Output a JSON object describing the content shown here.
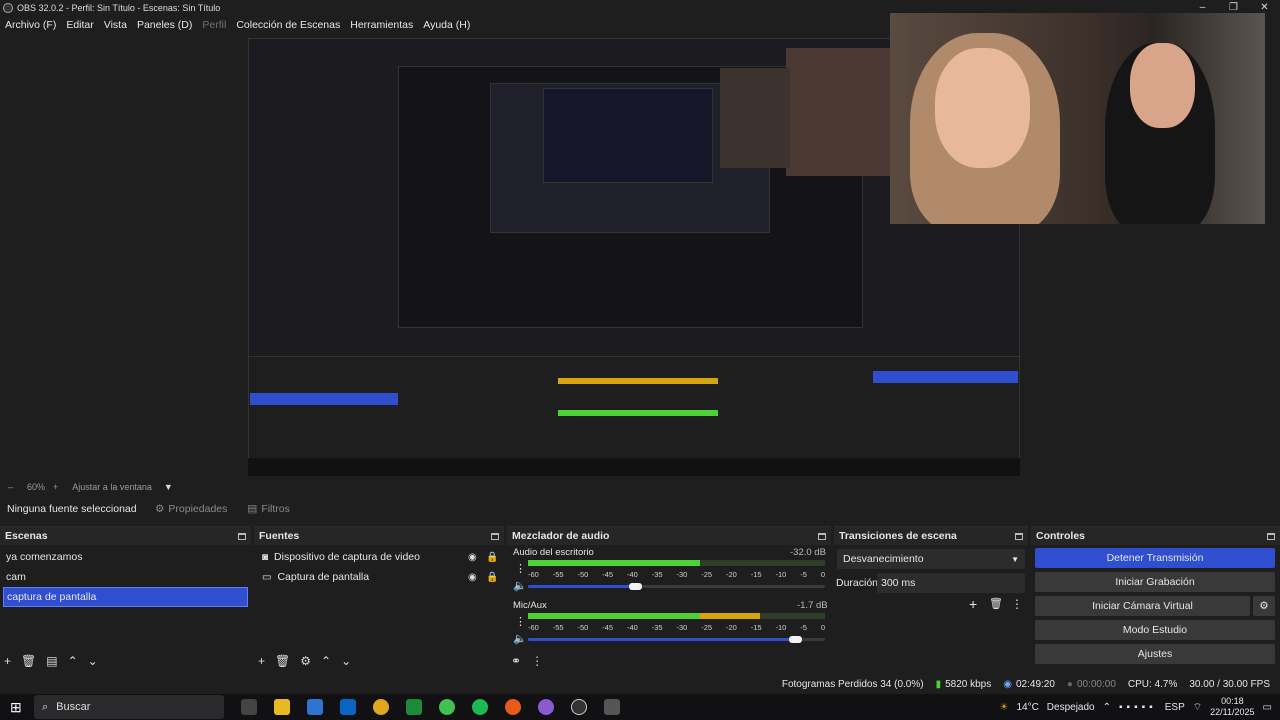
{
  "window": {
    "title": "OBS 32.0.2 - Perfil: Sin Título - Escenas: Sin Título",
    "controls": [
      "–",
      "❐",
      "✕"
    ]
  },
  "menu": [
    "Archivo (F)",
    "Editar",
    "Vista",
    "Paneles (D)",
    "Perfil",
    "Colección de Escenas",
    "Herramientas",
    "Ayuda (H)"
  ],
  "zoom": {
    "minus": "–",
    "value": "60%",
    "plus": "+",
    "fit": "Ajustar a la ventana"
  },
  "context": {
    "no_source": "Ninguna fuente seleccionad",
    "properties": "Propiedades",
    "filters": "Filtros"
  },
  "scenes": {
    "title": "Escenas",
    "items": [
      "ya comenzamos",
      "cam",
      "captura de pantalla"
    ],
    "selected": 2
  },
  "sources": {
    "title": "Fuentes",
    "items": [
      "Dispositivo de captura de video",
      "Captura de pantalla"
    ]
  },
  "mixer": {
    "title": "Mezclador de audio",
    "channels": [
      {
        "name": "Audio del escritorio",
        "db": "-32.0 dB",
        "level": 0.58,
        "volume": 0.36
      },
      {
        "name": "Mic/Aux",
        "db": "-1.7 dB",
        "level": 0.78,
        "volume": 0.9
      }
    ],
    "scale": [
      "-60",
      "-55",
      "-50",
      "-45",
      "-40",
      "-35",
      "-30",
      "-25",
      "-20",
      "-15",
      "-10",
      "-5",
      "0"
    ]
  },
  "transitions": {
    "title": "Transiciones de escena",
    "selected": "Desvanecimiento",
    "duration_label": "Duración",
    "duration_value": "300 ms"
  },
  "controls": {
    "title": "Controles",
    "buttons": [
      "Detener Transmisión",
      "Iniciar Grabación",
      "Iniciar Cámara Virtual",
      "Modo Estudio",
      "Ajustes"
    ]
  },
  "status": {
    "dropped": "Fotogramas Perdidos 34 (0.0%)",
    "bitrate": "5820 kbps",
    "stream_time": "02:49:20",
    "rec_time": "00:00:00",
    "cpu": "CPU: 4.7%",
    "fps": "30.00 / 30.00 FPS"
  },
  "taskbar": {
    "search_placeholder": "Buscar",
    "weather": "14°C",
    "weather_desc": "Despejado",
    "lang": "ESP",
    "time": "00:18",
    "date": "22/11/2025"
  },
  "colors": {
    "accent": "#2f4fd0",
    "meter_green": "#4cd137",
    "meter_yellow": "#d6a50e",
    "meter_red": "#c8202e"
  },
  "icons": [
    "obs-icon",
    "gear-icon",
    "eye-icon",
    "lock-icon",
    "plus-icon",
    "trash-icon",
    "filter-icon",
    "up-icon",
    "down-icon",
    "speaker-icon",
    "more-icon",
    "windows-icon",
    "search-icon"
  ]
}
